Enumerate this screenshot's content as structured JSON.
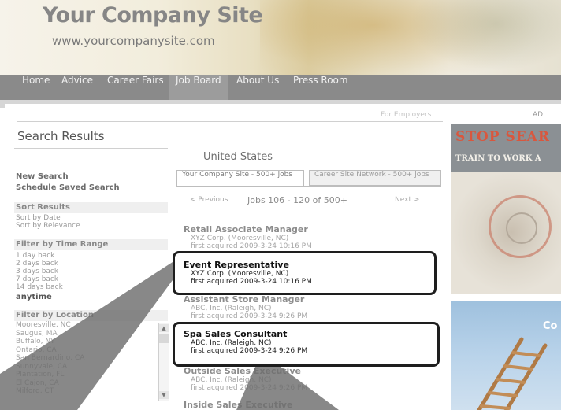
{
  "header": {
    "site_title": "Your Company Site",
    "site_url": "www.yourcompanysite.com"
  },
  "nav": {
    "items": [
      {
        "label": "Home"
      },
      {
        "label": "Advice"
      },
      {
        "label": "Career Fairs"
      },
      {
        "label": "Job Board",
        "active": true
      },
      {
        "label": "About Us"
      },
      {
        "label": "Press Room"
      }
    ]
  },
  "topbar": {
    "for_employers": "For Employers",
    "ad_label": "AD"
  },
  "sidebar": {
    "title": "Search Results",
    "new_search": "New Search",
    "schedule_saved_search": "Schedule Saved Search",
    "sort_heading": "Sort Results",
    "sort_options": [
      "Sort by Date",
      "Sort by Relevance"
    ],
    "time_heading": "Filter by Time Range",
    "time_options": [
      "1 day back",
      "2 days back",
      "3 days back",
      "7 days back",
      "14 days back"
    ],
    "time_selected": "anytime",
    "location_heading": "Filter by Location",
    "locations": [
      "Mooresville, NC",
      "Saugus, MA",
      "Buffalo, NY",
      "Ontario, CA",
      "San Bernardino, CA",
      "Sunnyvale, CA",
      "Plantation, FL",
      "El Cajon, CA",
      "Milford, CT"
    ]
  },
  "results": {
    "region": "United States",
    "tabs": [
      "Your Company Site - 500+ jobs",
      "Career Site Network - 500+ jobs"
    ],
    "pager": {
      "prev": "< Previous",
      "status": "Jobs 106 - 120 of 500+",
      "next": "Next >"
    },
    "jobs": [
      {
        "title": "Retail Associate Manager",
        "company": "XYZ Corp. (Mooresville, NC)",
        "acquired": "first acquired 2009-3-24 10:16 PM",
        "highlighted": false
      },
      {
        "title": "Event Representative",
        "company": "XYZ Corp. (Mooresville, NC)",
        "acquired": "first acquired 2009-3-24 10:16 PM",
        "highlighted": true
      },
      {
        "title": "Assistant Store Manager",
        "company": "ABC, Inc. (Raleigh, NC)",
        "acquired": "first acquired 2009-3-24 9:26 PM",
        "highlighted": false
      },
      {
        "title": "Spa Sales Consultant",
        "company": "ABC, Inc. (Raleigh, NC)",
        "acquired": "first acquired 2009-3-24 9:26 PM",
        "highlighted": true
      },
      {
        "title": "Outside Sales Executive",
        "company": "ABC, Inc. (Raleigh, NC)",
        "acquired": "first acquired 2009-3-24 9:26 PM",
        "highlighted": false
      },
      {
        "title": "Inside Sales Executive",
        "company": "",
        "acquired": "",
        "highlighted": false
      }
    ]
  },
  "ads": {
    "ad1_title": "STOP SEAR",
    "ad1_subtitle": "TRAIN TO WORK A",
    "ad2_text": "Co"
  },
  "colors": {
    "nav_bg": "#8a8a8a",
    "callout_border": "#1e1e1e",
    "ad_accent": "#d9573e"
  }
}
